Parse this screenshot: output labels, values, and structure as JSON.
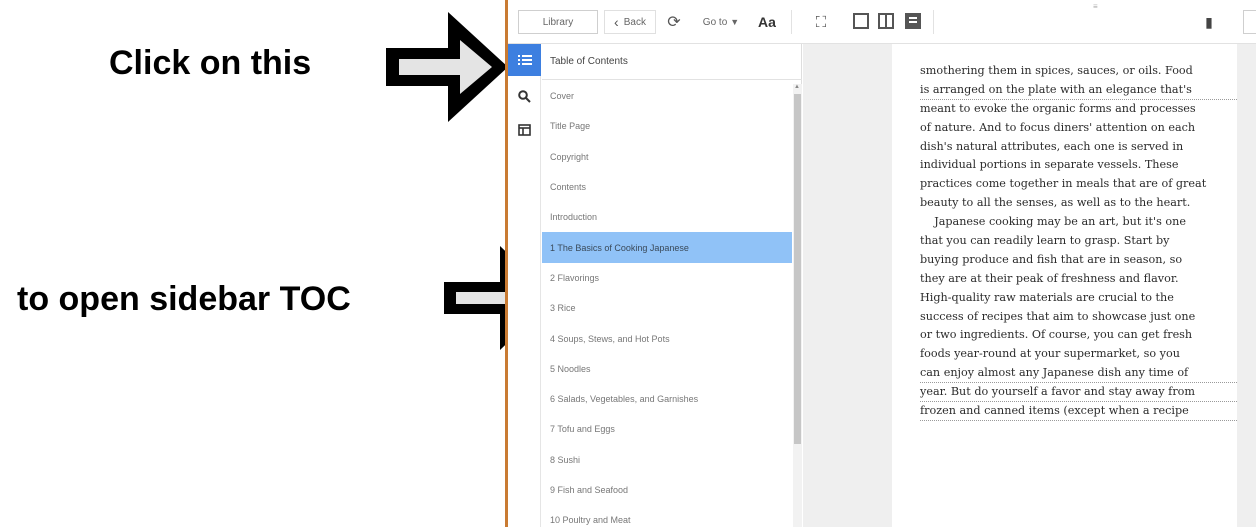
{
  "annotations": {
    "caption_top": "Click on this",
    "caption_bottom": "to open sidebar TOC"
  },
  "toolbar": {
    "library_label": "Library",
    "back_label": "Back",
    "goto_label": "Go to",
    "font_label": "Aa"
  },
  "sidebar": {
    "header": "Table of Contents",
    "items": [
      "Cover",
      "Title Page",
      "Copyright",
      "Contents",
      "Introduction",
      "1 The Basics of Cooking Japanese",
      "2 Flavorings",
      "3 Rice",
      "4 Soups, Stews, and Hot Pots",
      "5 Noodles",
      "6 Salads, Vegetables, and Garnishes",
      "7 Tofu and Eggs",
      "8 Sushi",
      "9 Fish and Seafood",
      "10 Poultry and Meat"
    ],
    "active_index": 5
  },
  "reader": {
    "lines": [
      "smothering them in spices, sauces, or oils. Food",
      "is arranged on the plate with an elegance that's",
      "meant to evoke the organic forms and processes",
      "of nature. And to focus diners' attention on each",
      "dish's natural attributes, each one is served in",
      "individual portions in separate vessels. These",
      "practices come together in meals that are of great",
      "beauty to all the senses, as well as to the heart.",
      "    Japanese cooking may be an art, but it's one",
      "that you can readily learn to grasp. Start by",
      "buying produce and fish that are in season, so",
      "they are at their peak of freshness and flavor.",
      "High-quality raw materials are crucial to the",
      "success of recipes that aim to showcase just one",
      "or two ingredients. Of course, you can get fresh",
      "foods year-round at your supermarket, so you",
      "can enjoy almost any Japanese dish any time of",
      "year. But do yourself a favor and stay away from",
      "frozen and canned items (except when a recipe"
    ],
    "underlined_lines": [
      1,
      16,
      17,
      18
    ]
  },
  "colors": {
    "accent": "#3d7fe0",
    "active_item": "#90c2f7",
    "window_edge": "#c97b33"
  }
}
